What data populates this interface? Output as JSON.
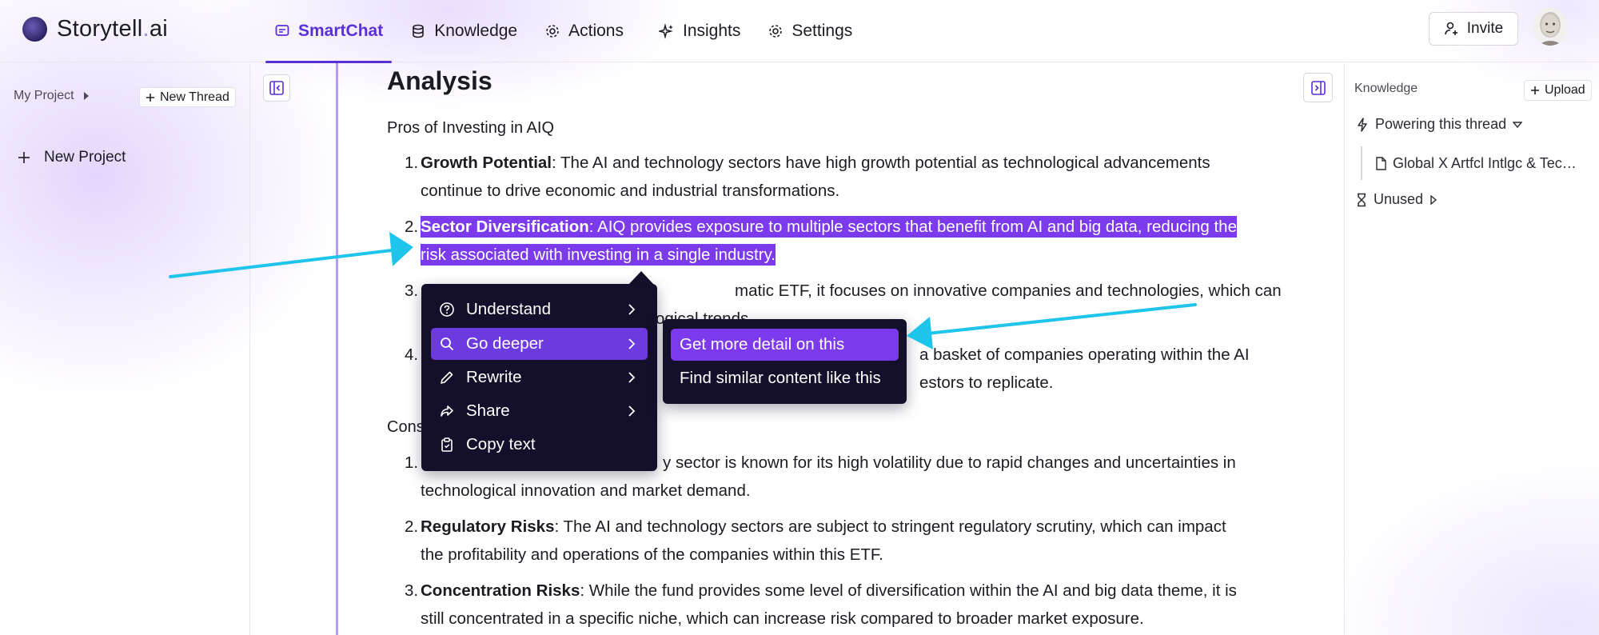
{
  "app": {
    "logo_text": "Storytell",
    "logo_dot": ".",
    "logo_suffix": "ai"
  },
  "nav": {
    "smartchat": "SmartChat",
    "knowledge": "Knowledge",
    "actions": "Actions",
    "insights": "Insights",
    "settings": "Settings",
    "active": "SmartChat"
  },
  "header": {
    "invite_label": "Invite"
  },
  "sidebar": {
    "project_label": "My Project",
    "new_thread_label": "New Thread",
    "new_project_label": "New Project"
  },
  "main": {
    "heading": "Analysis",
    "pros_heading": "Pros of Investing in AIQ",
    "pros": [
      {
        "num": "1.",
        "bold": "Growth Potential",
        "text": ": The AI and technology sectors have high growth potential as technological advancements continue to drive economic and industrial transformations."
      },
      {
        "num": "2.",
        "bold": "Sector Diversification",
        "text": ": AIQ provides exposure to multiple sectors that benefit from AI and big data, reducing the risk associated with investing in a single industry."
      },
      {
        "num": "3.",
        "text_visible_right": "matic ETF, it focuses on innovative companies and technologies, which can",
        "text_visible_line2": "ogical trends."
      },
      {
        "num": "4.",
        "text_visible_right": "a basket of companies operating within the AI",
        "text_visible_line2": "estors to replicate."
      }
    ],
    "cons_heading_visible": "Cons",
    "cons": [
      {
        "num": "1.",
        "text_visible_right": "y sector is known for its high volatility due to rapid changes and uncertainties in",
        "text_line2": "technological innovation and market demand."
      },
      {
        "num": "2.",
        "bold": "Regulatory Risks",
        "text": ": The AI and technology sectors are subject to stringent regulatory scrutiny, which can impact the profitability and operations of the companies within this ETF."
      },
      {
        "num": "3.",
        "bold": "Concentration Risks",
        "text": ": While the fund provides some level of diversification within the AI and big data theme, it is still concentrated in a specific niche, which can increase risk compared to broader market exposure."
      }
    ]
  },
  "context_menu": {
    "items": [
      {
        "label": "Understand",
        "icon": "help-circle-icon"
      },
      {
        "label": "Go deeper",
        "icon": "search-icon",
        "active": true
      },
      {
        "label": "Rewrite",
        "icon": "pencil-icon"
      },
      {
        "label": "Share",
        "icon": "share-arrow-icon"
      },
      {
        "label": "Copy text",
        "icon": "clipboard-icon"
      }
    ],
    "submenu": [
      {
        "label": "Get more detail on this",
        "active": true
      },
      {
        "label": "Find similar content like this"
      }
    ]
  },
  "right_panel": {
    "title": "Knowledge",
    "upload_label": "Upload",
    "powering_label": "Powering this thread",
    "source_label": "Global X Artfcl Intlgc & Tec…",
    "unused_label": "Unused"
  },
  "colors": {
    "accent": "#5b2fd6",
    "highlight": "#7c3aed",
    "menu_bg": "#14102b",
    "annotation_arrow": "#1fc4ec"
  }
}
